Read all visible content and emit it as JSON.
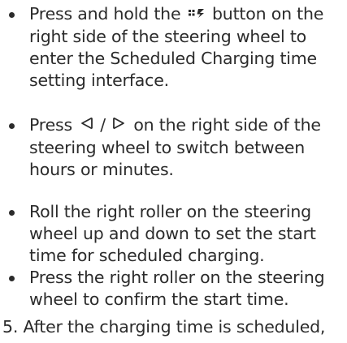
{
  "bullets": [
    {
      "before_icon": "Press and hold the ",
      "icon": "scheduled-charging-icon",
      "after_icon": " button on the right side of the steering wheel to enter the Scheduled Charging time setting interface."
    },
    {
      "press": "Press ",
      "left_icon": "left-triangle-icon",
      "slash": "/",
      "right_icon": "right-triangle-icon",
      "rest": " on the right side of the steering wheel to switch between hours or minutes."
    },
    {
      "text": "Roll the right roller on the steering wheel up and down to set the start time for scheduled charging."
    },
    {
      "text": "Press the right roller on the steering wheel to confirm the start time."
    }
  ],
  "step5": {
    "number": "5.",
    "text": "After the charging time is scheduled,"
  }
}
